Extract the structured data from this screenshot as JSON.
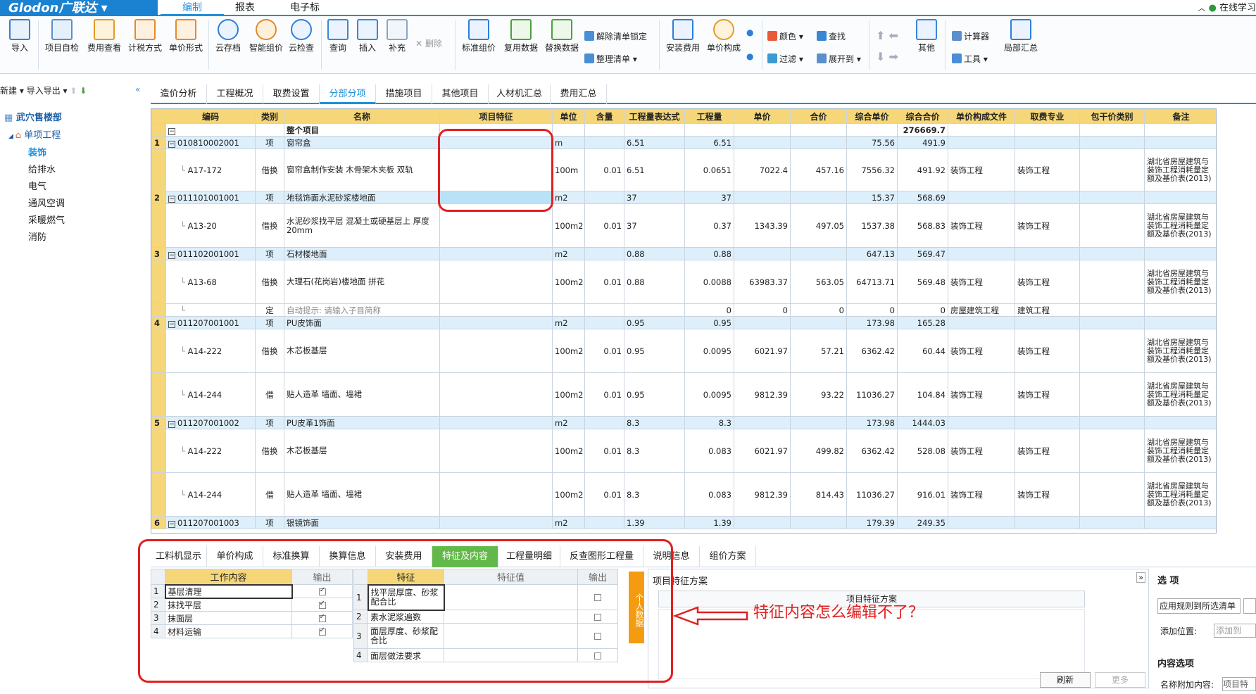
{
  "app": {
    "logo": "Glodon广联达 ▾",
    "menu_tabs": [
      "编制",
      "报表",
      "电子标"
    ],
    "active_menu": "编制",
    "right_link": "在线学习"
  },
  "ribbon": {
    "large": [
      {
        "label": "导入",
        "icon": "import-icon"
      },
      {
        "label": "项目自检",
        "icon": "check-icon"
      },
      {
        "label": "费用查看",
        "icon": "view-icon"
      },
      {
        "label": "计税方式",
        "icon": "tax-icon"
      },
      {
        "label": "单价形式",
        "icon": "price-icon"
      },
      {
        "label": "云存档",
        "icon": "cloud-upload-icon"
      },
      {
        "label": "智能组价",
        "icon": "smart-icon"
      },
      {
        "label": "云检查",
        "icon": "cloud-check-icon"
      },
      {
        "label": "查询",
        "icon": "query-icon"
      },
      {
        "label": "插入",
        "icon": "insert-icon"
      },
      {
        "label": "补充",
        "icon": "supplement-icon"
      },
      {
        "label": "标准组价",
        "icon": "standard-icon"
      },
      {
        "label": "复用数据",
        "icon": "reuse-icon"
      },
      {
        "label": "替换数据",
        "icon": "replace-icon"
      },
      {
        "label": "安装费用",
        "icon": "install-icon"
      },
      {
        "label": "单价构成",
        "icon": "compose-icon"
      },
      {
        "label": "其他",
        "icon": "other-icon"
      },
      {
        "label": "局部汇总",
        "icon": "sum-icon"
      }
    ],
    "small": {
      "delete": "删除",
      "unlock": "解除清单锁定",
      "tidy": "整理清单",
      "color": "颜色",
      "search": "查找",
      "filter": "过滤",
      "expand": "展开到",
      "calculator": "计算器",
      "tools": "工具"
    }
  },
  "left": {
    "toolbar": [
      "新建",
      "导入导出"
    ],
    "tree": [
      "武穴售楼部",
      "单项工程",
      "装饰",
      "给排水",
      "电气",
      "通风空调",
      "采暖燃气",
      "消防"
    ]
  },
  "tabs": [
    "造价分析",
    "工程概况",
    "取费设置",
    "分部分项",
    "措施项目",
    "其他项目",
    "人材机汇总",
    "费用汇总"
  ],
  "active_tab": "分部分项",
  "grid": {
    "headers": [
      "编码",
      "类别",
      "名称",
      "项目特征",
      "单位",
      "含量",
      "工程量表达式",
      "工程量",
      "单价",
      "合价",
      "综合单价",
      "综合合价",
      "单价构成文件",
      "取费专业",
      "包干价类别",
      "备注"
    ],
    "rows": [
      {
        "rn": "",
        "code": "",
        "type": "",
        "name": "整个项目",
        "unit": "",
        "qty_ex": "",
        "qty": "",
        "price": "",
        "total": "",
        "cprice": "",
        "ctotal": "276669.7",
        "file": "",
        "prof": "",
        "note": "",
        "qd": false,
        "h": 18
      },
      {
        "rn": "1",
        "code": "010810002001",
        "type": "项",
        "name": "窗帘盒",
        "unit": "m",
        "hl": "",
        "qty_ex": "6.51",
        "qty": "6.51",
        "price": "",
        "total": "",
        "cprice": "75.56",
        "ctotal": "491.9",
        "file": "",
        "prof": "",
        "note": "",
        "qd": true,
        "h": 18
      },
      {
        "rn": "",
        "code": "A17-172",
        "type": "借换",
        "name": "窗帘盒制作安装 木骨架木夹板 双轨",
        "unit": "100m",
        "hl": "0.01",
        "qty_ex": "6.51",
        "qty": "0.0651",
        "price": "7022.4",
        "total": "457.16",
        "cprice": "7556.32",
        "ctotal": "491.92",
        "file": "装饰工程",
        "prof": "装饰工程",
        "note": "湖北省房屋建筑与装饰工程消耗量定额及基价表(2013)",
        "qd": false,
        "h": 60
      },
      {
        "rn": "2",
        "code": "011101001001",
        "type": "项",
        "name": "地毯饰面水泥砂浆楼地面",
        "unit": "m2",
        "hl": "",
        "qty_ex": "37",
        "qty": "37",
        "price": "",
        "total": "",
        "cprice": "15.37",
        "ctotal": "568.69",
        "file": "",
        "prof": "",
        "note": "",
        "qd": true,
        "h": 18
      },
      {
        "rn": "",
        "code": "A13-20",
        "type": "借换",
        "name": "水泥砂浆找平层 混凝土或硬基层上 厚度20mm",
        "unit": "100m2",
        "hl": "0.01",
        "qty_ex": "37",
        "qty": "0.37",
        "price": "1343.39",
        "total": "497.05",
        "cprice": "1537.38",
        "ctotal": "568.83",
        "file": "装饰工程",
        "prof": "装饰工程",
        "note": "湖北省房屋建筑与装饰工程消耗量定额及基价表(2013)",
        "qd": false,
        "h": 62
      },
      {
        "rn": "3",
        "code": "011102001001",
        "type": "项",
        "name": "石材楼地面",
        "unit": "m2",
        "hl": "",
        "qty_ex": "0.88",
        "qty": "0.88",
        "price": "",
        "total": "",
        "cprice": "647.13",
        "ctotal": "569.47",
        "file": "",
        "prof": "",
        "note": "",
        "qd": true,
        "h": 18
      },
      {
        "rn": "",
        "code": "A13-68",
        "type": "借换",
        "name": "大理石(花岗岩)楼地面 拼花",
        "unit": "100m2",
        "hl": "0.01",
        "qty_ex": "0.88",
        "qty": "0.0088",
        "price": "63983.37",
        "total": "563.05",
        "cprice": "64713.71",
        "ctotal": "569.48",
        "file": "装饰工程",
        "prof": "装饰工程",
        "note": "湖北省房屋建筑与装饰工程消耗量定额及基价表(2013)",
        "qd": false,
        "h": 62
      },
      {
        "rn": "",
        "code": "",
        "type": "定",
        "name": "自动提示: 请输入子目简称",
        "unit": "",
        "hl": "",
        "qty_ex": "",
        "qty": "0",
        "price": "0",
        "total": "0",
        "cprice": "0",
        "ctotal": "0",
        "file": "房屋建筑工程",
        "prof": "建筑工程",
        "note": "",
        "qd": false,
        "h": 18
      },
      {
        "rn": "4",
        "code": "011207001001",
        "type": "项",
        "name": "PU皮饰面",
        "unit": "m2",
        "hl": "",
        "qty_ex": "0.95",
        "qty": "0.95",
        "price": "",
        "total": "",
        "cprice": "173.98",
        "ctotal": "165.28",
        "file": "",
        "prof": "",
        "note": "",
        "qd": true,
        "h": 18
      },
      {
        "rn": "",
        "code": "A14-222",
        "type": "借换",
        "name": "木芯板基层",
        "unit": "100m2",
        "hl": "0.01",
        "qty_ex": "0.95",
        "qty": "0.0095",
        "price": "6021.97",
        "total": "57.21",
        "cprice": "6362.42",
        "ctotal": "60.44",
        "file": "装饰工程",
        "prof": "装饰工程",
        "note": "湖北省房屋建筑与装饰工程消耗量定额及基价表(2013)",
        "qd": false,
        "h": 62
      },
      {
        "rn": "",
        "code": "A14-244",
        "type": "借",
        "name": "贴人造革 墙面、墙裙",
        "unit": "100m2",
        "hl": "0.01",
        "qty_ex": "0.95",
        "qty": "0.0095",
        "price": "9812.39",
        "total": "93.22",
        "cprice": "11036.27",
        "ctotal": "104.84",
        "file": "装饰工程",
        "prof": "装饰工程",
        "note": "湖北省房屋建筑与装饰工程消耗量定额及基价表(2013)",
        "qd": false,
        "h": 62
      },
      {
        "rn": "5",
        "code": "011207001002",
        "type": "项",
        "name": "PU皮革1饰面",
        "unit": "m2",
        "hl": "",
        "qty_ex": "8.3",
        "qty": "8.3",
        "price": "",
        "total": "",
        "cprice": "173.98",
        "ctotal": "1444.03",
        "file": "",
        "prof": "",
        "note": "",
        "qd": true,
        "h": 18
      },
      {
        "rn": "",
        "code": "A14-222",
        "type": "借换",
        "name": "木芯板基层",
        "unit": "100m2",
        "hl": "0.01",
        "qty_ex": "8.3",
        "qty": "0.083",
        "price": "6021.97",
        "total": "499.82",
        "cprice": "6362.42",
        "ctotal": "528.08",
        "file": "装饰工程",
        "prof": "装饰工程",
        "note": "湖北省房屋建筑与装饰工程消耗量定额及基价表(2013)",
        "qd": false,
        "h": 62
      },
      {
        "rn": "",
        "code": "A14-244",
        "type": "借",
        "name": "贴人造革 墙面、墙裙",
        "unit": "100m2",
        "hl": "0.01",
        "qty_ex": "8.3",
        "qty": "0.083",
        "price": "9812.39",
        "total": "814.43",
        "cprice": "11036.27",
        "ctotal": "916.01",
        "file": "装饰工程",
        "prof": "装饰工程",
        "note": "湖北省房屋建筑与装饰工程消耗量定额及基价表(2013)",
        "qd": false,
        "h": 62
      },
      {
        "rn": "6",
        "code": "011207001003",
        "type": "项",
        "name": "银镜饰面",
        "unit": "m2",
        "hl": "",
        "qty_ex": "1.39",
        "qty": "1.39",
        "price": "",
        "total": "",
        "cprice": "179.39",
        "ctotal": "249.35",
        "file": "",
        "prof": "",
        "note": "",
        "qd": true,
        "h": 18
      }
    ]
  },
  "bottom": {
    "tabs": [
      "工料机显示",
      "单价构成",
      "标准换算",
      "换算信息",
      "安装费用",
      "特征及内容",
      "工程量明细",
      "反查图形工程量",
      "说明信息",
      "组价方案"
    ],
    "active_tab": "特征及内容",
    "work": {
      "headers": [
        "工作内容",
        "输出"
      ],
      "rows": [
        "基层清理",
        "抹找平层",
        "抹面层",
        "材料运输"
      ]
    },
    "feature": {
      "headers": [
        "特征",
        "特征值",
        "输出"
      ],
      "rows": [
        "找平层厚度、砂浆配合比",
        "素水泥浆遍数",
        "面层厚度、砂浆配合比",
        "面层做法要求"
      ]
    },
    "personal": "个人数据",
    "scheme_title": "项目特征方案",
    "scheme_header": "项目特征方案",
    "refresh": "刷新",
    "more": "更多",
    "options": {
      "title": "选 项",
      "apply": "应用规则到所选清单",
      "add_pos": "添加位置:",
      "add_to": "添加到",
      "content_title": "内容选项",
      "name_add": "名称附加内容:",
      "name_val": "项目特"
    }
  },
  "annotation": "特征内容怎么编辑不了？",
  "colors": {
    "accent": "#1e8fd8",
    "header": "#f5d77a",
    "qd_row": "#ddeffb",
    "active_green": "#62b94a",
    "annotation": "#e02020"
  }
}
